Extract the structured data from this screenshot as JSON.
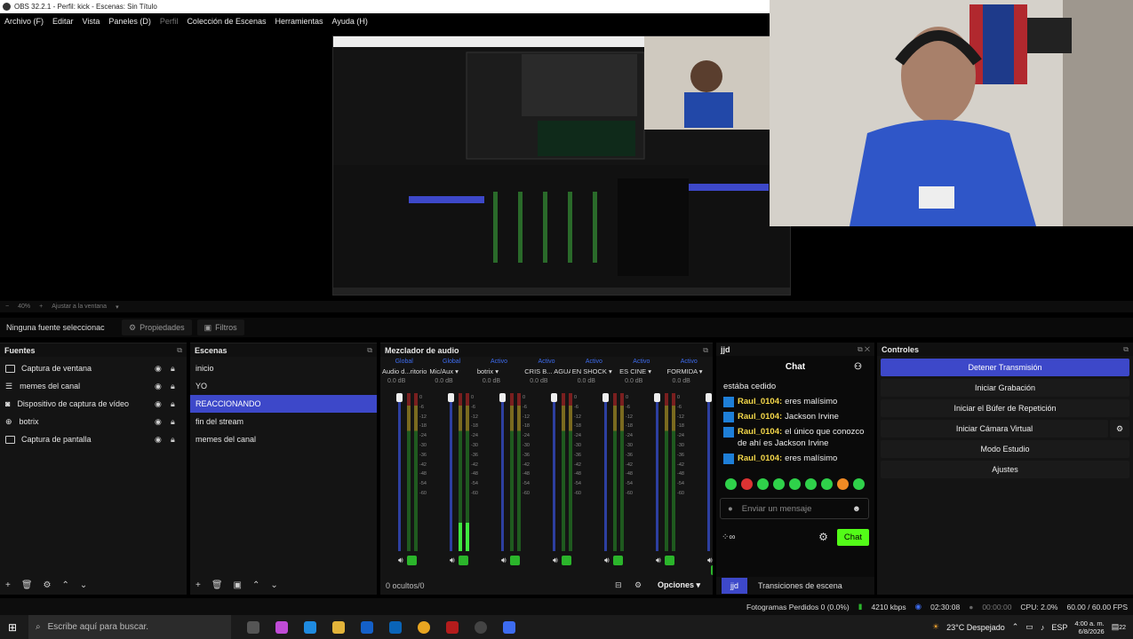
{
  "window": {
    "title": "OBS 32.2.1 - Perfil: kick - Escenas: Sin Título"
  },
  "menu": [
    "Archivo (F)",
    "Editar",
    "Vista",
    "Paneles (D)",
    "Perfil",
    "Colección de Escenas",
    "Herramientas",
    "Ayuda (H)"
  ],
  "zoom": {
    "percent": "40%",
    "fit_label": "Ajustar a la ventana"
  },
  "source_bar": {
    "no_selection": "Ninguna fuente seleccionac",
    "properties": "Propiedades",
    "filters": "Filtros"
  },
  "sources": {
    "title": "Fuentes",
    "items": [
      {
        "label": "Captura de ventana",
        "icon": "window-icon"
      },
      {
        "label": "memes del canal",
        "icon": "list-icon"
      },
      {
        "label": "Dispositivo de captura de vídeo",
        "icon": "camera-icon"
      },
      {
        "label": "botrix",
        "icon": "browser-icon"
      },
      {
        "label": "Captura de pantalla",
        "icon": "monitor-icon"
      }
    ]
  },
  "scenes": {
    "title": "Escenas",
    "items": [
      "inicio",
      "YO",
      "REACCIONANDO",
      "fin del stream",
      "memes del canal"
    ],
    "selected_index": 2
  },
  "mixer": {
    "title": "Mezclador de audio",
    "channels": [
      {
        "status": "Global",
        "name": "Audio d...ritorio",
        "db": "0.0 dB",
        "level": 0,
        "fader": 1.0
      },
      {
        "status": "Global",
        "name": "Mic/Aux",
        "db": "0.0 dB",
        "level": 0.18,
        "fader": 1.0
      },
      {
        "status": "Activo",
        "name": "botrix",
        "db": "0.0 dB",
        "level": 0,
        "fader": 1.0
      },
      {
        "status": "Activo",
        "name": "CRIS B... AGUA",
        "db": "0.0 dB",
        "level": 0,
        "fader": 1.0
      },
      {
        "status": "Activo",
        "name": "EN SHOCK",
        "db": "0.0 dB",
        "level": 0,
        "fader": 1.0
      },
      {
        "status": "Activo",
        "name": "ES CINE",
        "db": "0.0 dB",
        "level": 0,
        "fader": 1.0
      },
      {
        "status": "Activo",
        "name": "FORMIDA",
        "db": "0.0 dB",
        "level": 0,
        "fader": 1.0
      }
    ],
    "scale": [
      "0",
      "-6",
      "-12",
      "-18",
      "-24",
      "-30",
      "-36",
      "-42",
      "-48",
      "-54",
      "-60"
    ],
    "hidden": "0 ocultos/0",
    "options": "Opciones"
  },
  "chat": {
    "dock_title": "jjd",
    "header": "Chat",
    "messages": [
      {
        "user": "",
        "text": "estába cedido"
      },
      {
        "user": "Raul_0104:",
        "text": "eres malísimo"
      },
      {
        "user": "Raul_0104:",
        "text": "Jackson Irvine"
      },
      {
        "user": "Raul_0104:",
        "text": "el único que conozco de ahí es Jackson Irvine"
      },
      {
        "user": "Raul_0104:",
        "text": "eres malísimo"
      }
    ],
    "input_placeholder": "Enviar un mensaje",
    "send_label": "Chat",
    "tabs": [
      "jjd",
      "Transiciones de escena"
    ],
    "accent": "#53fc18"
  },
  "controls": {
    "title": "Controles",
    "buttons": [
      "Detener Transmisión",
      "Iniciar Grabación",
      "Iniciar el Búfer de Repetición",
      "Iniciar Cámara Virtual",
      "Modo Estudio",
      "Ajustes"
    ]
  },
  "status": {
    "dropped": "Fotogramas Perdidos 0 (0.0%)",
    "bitrate": "4210 kbps",
    "stream_time": "02:30:08",
    "rec_time": "00:00:00",
    "cpu": "CPU: 2.0%",
    "fps": "60.00 / 60.00 FPS"
  },
  "taskbar": {
    "search_placeholder": "Escribe aquí para buscar.",
    "weather": "23°C  Despejado",
    "lang": "ESP",
    "time": "4:00 a. m.",
    "date": "6/8/2026",
    "notif": "22"
  },
  "colors": {
    "accent": "#3d48c9",
    "kick_green": "#53fc18"
  }
}
